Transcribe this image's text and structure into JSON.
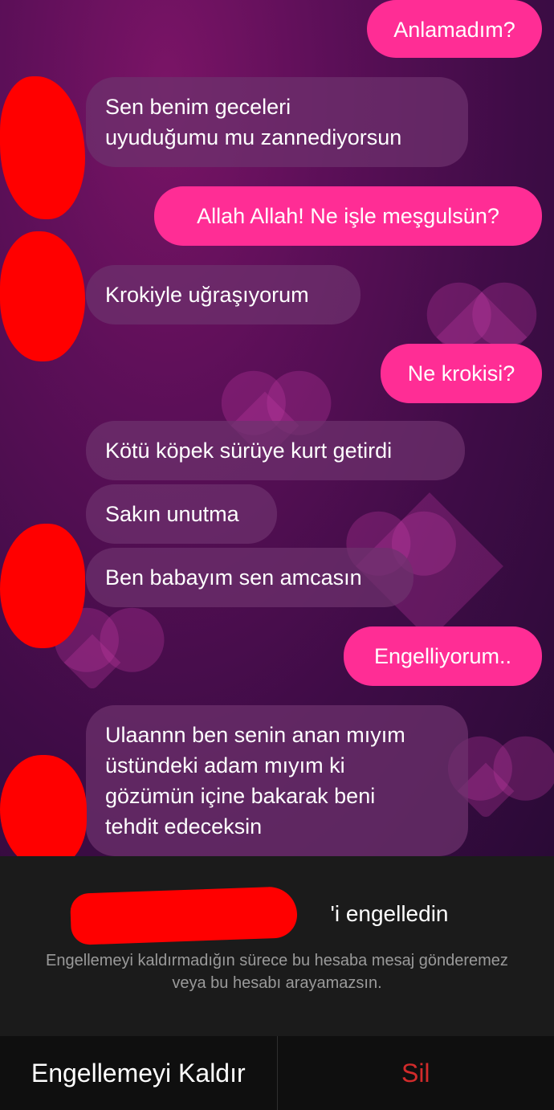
{
  "messages": [
    {
      "side": "out",
      "text": "Anlamadım?"
    },
    {
      "side": "in",
      "text": "Sen benim geceleri\nuyuduğumu mu zannediyorsun"
    },
    {
      "side": "out",
      "text": "Allah Allah! Ne işle meşgulsün?"
    },
    {
      "side": "in",
      "text": "Krokiyle uğraşıyorum"
    },
    {
      "side": "out",
      "text": "Ne krokisi?"
    },
    {
      "side": "in",
      "text": "Kötü köpek sürüye kurt getirdi"
    },
    {
      "side": "in",
      "text": "Sakın unutma"
    },
    {
      "side": "in",
      "text": "Ben babayım sen amcasın"
    },
    {
      "side": "out",
      "text": "Engelliyorum.."
    },
    {
      "side": "in",
      "text": "Ulaannn ben senin anan mıyım\nüstündeki adam mıyım ki\ngözümün içine bakarak beni\ntehdit edeceksin"
    }
  ],
  "block_sheet": {
    "title_suffix": "'i engelledin",
    "description": "Engellemeyi kaldırmadığın sürece bu hesaba mesaj gönderemez veya bu hesabı arayamazsın."
  },
  "actions": {
    "unblock_label": "Engellemeyi Kaldır",
    "delete_label": "Sil"
  },
  "colors": {
    "outgoing_bubble": "#ff2d95",
    "incoming_bubble": "#6e326e",
    "delete_text": "#d22b2b",
    "redaction": "#ff0000"
  }
}
